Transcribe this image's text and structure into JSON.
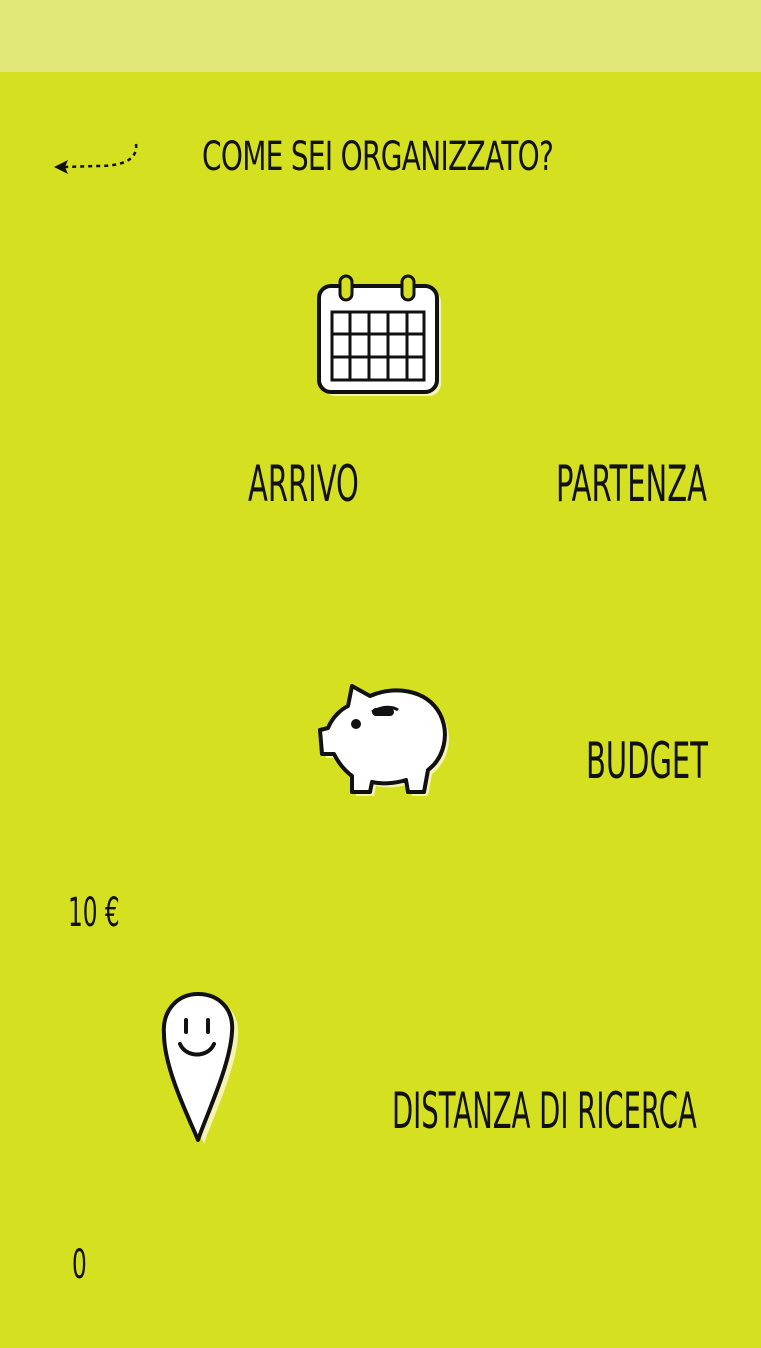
{
  "header": {
    "title": "COME SEI ORGANIZZATO?"
  },
  "dates": {
    "arrival_label": "ARRIVO",
    "departure_label": "PARTENZA"
  },
  "budget": {
    "label": "BUDGET",
    "value": "10 €"
  },
  "distance": {
    "label": "DISTANZA DI RICERCA",
    "value": "0"
  },
  "icons": {
    "back": "back-arrow-icon",
    "calendar": "calendar-icon",
    "budget": "piggy-bank-icon",
    "distance": "map-pin-smiley-icon"
  },
  "colors": {
    "background": "#d5e021",
    "status_bar": "#e2e878",
    "ink": "#111111",
    "icon_fill": "#ffffff"
  }
}
